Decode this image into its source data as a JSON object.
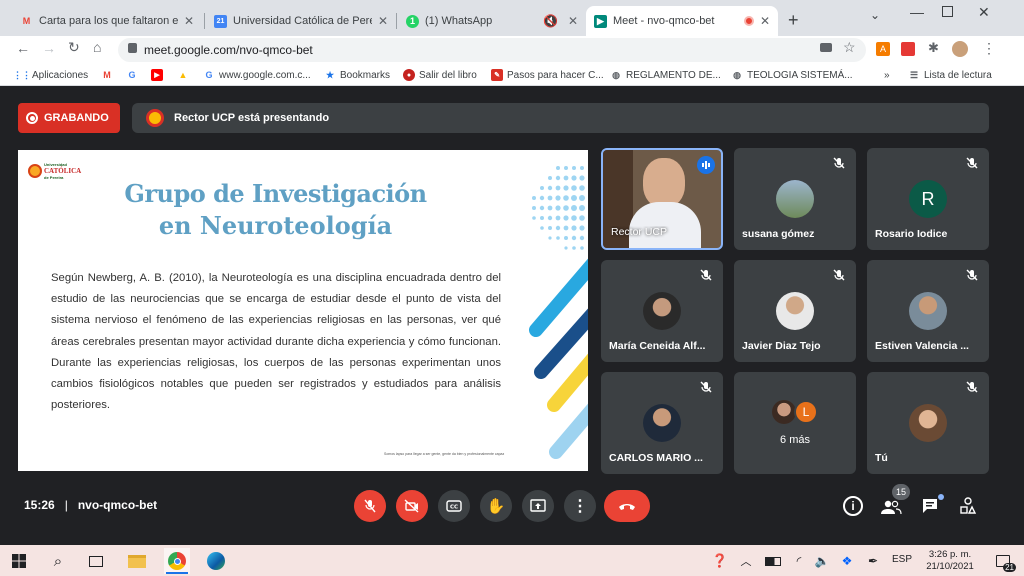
{
  "browser": {
    "tabs": [
      {
        "title": "Carta para los que faltaron el sáb",
        "fav": "M",
        "favcolor": "#ea4335"
      },
      {
        "title": "Universidad Católica de Pereira -",
        "fav": "21",
        "favcolor": "#4285f4"
      },
      {
        "title": "(1) WhatsApp",
        "fav": "1",
        "favcolor": "#25d366"
      },
      {
        "title": "Meet - nvo-qmco-bet",
        "fav": "M",
        "favcolor": "#00897b"
      }
    ],
    "url": "meet.google.com/nvo-qmco-bet",
    "bookmarks": [
      "Aplicaciones",
      "www.google.com.c...",
      "Bookmarks",
      "Salir del libro",
      "Pasos para hacer C...",
      "REGLAMENTO DE...",
      "TEOLOGIA SISTEMÁ..."
    ],
    "reading_list": "Lista de lectura",
    "more_bookmarks": "»"
  },
  "meet": {
    "recording_label": "GRABANDO",
    "presenting_label": "Rector UCP está presentando",
    "slide": {
      "logo_line1": "Universidad",
      "logo_line2": "CATÓLICA",
      "logo_line3": "de Pereira",
      "title_line1": "Grupo de Investigación",
      "title_line2": "en Neuroteología",
      "body": "Según Newberg, A. B. (2010), la Neuroteología es una disciplina encuadrada dentro del estudio de las neurociencias que se encarga de estudiar desde el punto de vista del sistema nervioso el fenómeno de las experiencias religiosas en las personas, ver qué áreas cerebrales presentan mayor actividad durante dicha experiencia y cómo funcionan. Durante las experiencias religiosas, los cuerpos de las personas experimentan unos cambios fisiológicos notables que pueden ser registrados y estudiados para análisis posteriores.",
      "footer": "Somos lapso para llegar a ser gente, gente da bien y profesionalmente capaz"
    },
    "participants": [
      {
        "name": "Rector UCP"
      },
      {
        "name": "susana gómez"
      },
      {
        "name": "Rosario Iodice",
        "initial": "R"
      },
      {
        "name": "María Ceneida Alf..."
      },
      {
        "name": "Javier Diaz Tejo"
      },
      {
        "name": "Estiven Valencia ..."
      },
      {
        "name": "CARLOS MARIO ..."
      },
      {
        "name": "6 más",
        "initial": "L"
      },
      {
        "name": "Tú"
      }
    ],
    "time": "15:26",
    "divider": "|",
    "meeting_code": "nvo-qmco-bet",
    "participant_count": "15"
  },
  "taskbar": {
    "language": "ESP",
    "clock_time": "3:26 p. m.",
    "clock_date": "21/10/2021",
    "notif_count": "21"
  }
}
